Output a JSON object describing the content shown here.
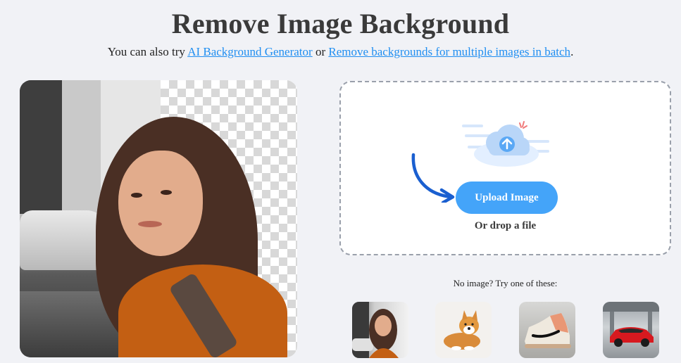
{
  "header": {
    "title": "Remove Image Background",
    "subtitle_prefix": "You can also try ",
    "link_generator": "AI Background Generator",
    "subtitle_or": " or ",
    "link_batch": "Remove backgrounds for multiple images in batch",
    "subtitle_suffix": "."
  },
  "hero": {
    "image": "woman-background-removed-example"
  },
  "upload": {
    "icon": "cloud-upload-icon",
    "button_label": "Upload Image",
    "drop_text": "Or drop a file"
  },
  "samples": {
    "label": "No image? Try one of these:",
    "items": [
      {
        "name": "sample-woman"
      },
      {
        "name": "sample-dog"
      },
      {
        "name": "sample-sneaker"
      },
      {
        "name": "sample-red-car"
      }
    ]
  },
  "colors": {
    "accent": "#44a4f9",
    "link": "#1f8ef1",
    "background": "#f1f2f6"
  }
}
